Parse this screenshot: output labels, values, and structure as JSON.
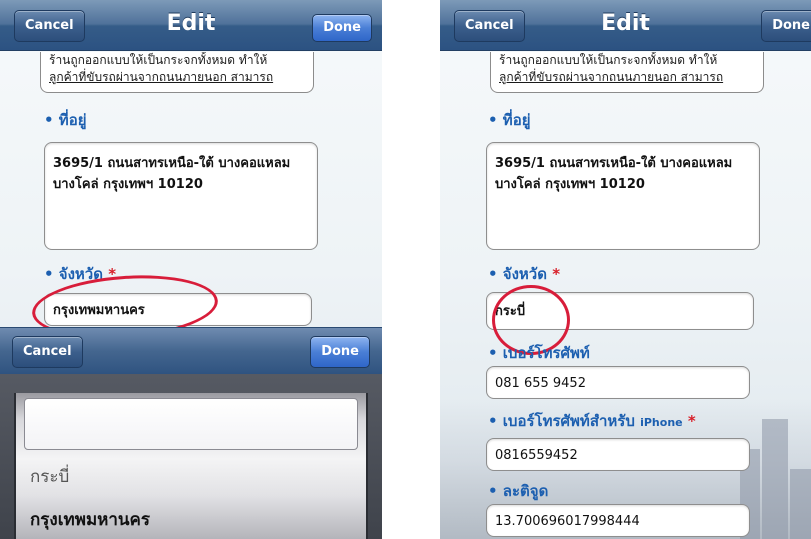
{
  "colors": {
    "navbar": "#3b6290",
    "label": "#1c5fb0",
    "required": "#d8202a",
    "annotation_circle": "#d81d3a"
  },
  "left": {
    "nav": {
      "cancel": "Cancel",
      "title": "Edit",
      "done": "Done"
    },
    "desc_line1": "ร้านถูกออกแบบให้เป็นกระจกทั้งหมด ทำให้",
    "desc_line2": "ลูกค้าที่ขับรถผ่านจากถนนภายนอก สามารถ",
    "address_label": "• ที่อยู่",
    "address_line1": "3695/1  ถนนสาทรเหนือ-ใต้ บางคอแหลม",
    "address_line2": "บางโคล่ กรุงเทพฯ 10120",
    "province_label": "• จังหวัด ",
    "required_mark": "*",
    "province_value": "กรุงเทพมหานคร",
    "picker": {
      "cancel": "Cancel",
      "done": "Done",
      "options": [
        "กระบี่",
        "กรุงเทพมหานคร"
      ]
    }
  },
  "right": {
    "nav": {
      "cancel": "Cancel",
      "title": "Edit",
      "done": "Done"
    },
    "desc_line1": "ร้านถูกออกแบบให้เป็นกระจกทั้งหมด ทำให้",
    "desc_line2": "ลูกค้าที่ขับรถผ่านจากถนนภายนอก สามารถ",
    "address_label": "• ที่อยู่",
    "address_line1": "3695/1  ถนนสาทรเหนือ-ใต้ บางคอแหลม",
    "address_line2": "บางโคล่ กรุงเทพฯ 10120",
    "province_label": "• จังหวัด ",
    "required_mark": "*",
    "province_value": "กระบี่",
    "phone_label": "• เบอร์โทรศัพท์",
    "phone_value": "081 655 9452",
    "iphone_label": "• เบอร์โทรศัพท์สำหรับ ",
    "iphone_label_suffix": "iPhone",
    "iphone_value": "0816559452",
    "latitude_label": "• ละติจูด",
    "latitude_value": "13.700696017998444"
  }
}
